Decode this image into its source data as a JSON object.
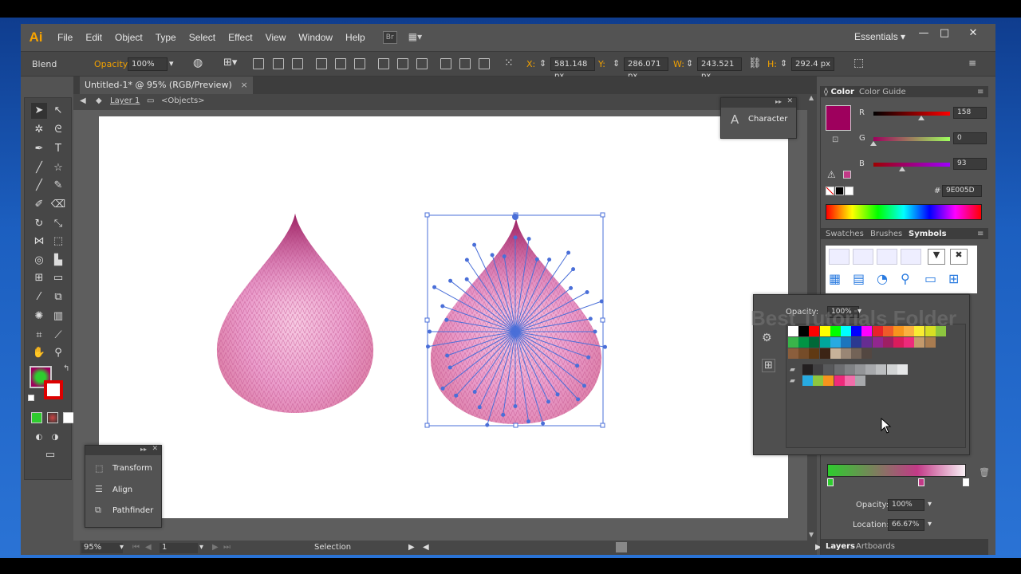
{
  "app": {
    "logo": "Ai",
    "workspace": "Essentials",
    "bridge_label": "Br",
    "window_controls": {
      "minimize": "—",
      "maximize": "□",
      "close": "✕"
    }
  },
  "menubar": {
    "items": [
      "File",
      "Edit",
      "Object",
      "Type",
      "Select",
      "Effect",
      "View",
      "Window",
      "Help"
    ]
  },
  "control": {
    "mode_label": "Blend",
    "opacity_label": "Opacity:",
    "opacity_value": "100%",
    "x_label": "X:",
    "x_value": "581.148 px",
    "y_label": "Y:",
    "y_value": "286.071 px",
    "w_label": "W:",
    "w_value": "243.521 px",
    "h_label": "H:",
    "h_value": "292.4 px"
  },
  "document": {
    "tab_title": "Untitled-1* @ 95% (RGB/Preview)",
    "close_icon": "×",
    "layer": "Layer 1",
    "objects": "<Objects>"
  },
  "character_panel": {
    "title": "Character",
    "glyph": "A"
  },
  "mini_panel": {
    "items": [
      "Transform",
      "Align",
      "Pathfinder"
    ]
  },
  "color_panel": {
    "tabs": [
      "Color",
      "Color Guide"
    ],
    "r_label": "R",
    "r_value": "158",
    "g_label": "G",
    "g_value": "0",
    "b_label": "B",
    "b_value": "93",
    "hash": "#",
    "hex": "9E005D",
    "fill_color": "#9e005d"
  },
  "library_tabs": [
    "Swatches",
    "Brushes",
    "Symbols"
  ],
  "swatch_popup": {
    "opacity_label": "Opacity:",
    "opacity_value": "100%",
    "watermark": "Best Tutorials Folder"
  },
  "gradient_panel": {
    "opacity_label": "Opacity:",
    "opacity_value": "100%",
    "location_label": "Location:",
    "location_value": "66.67%"
  },
  "bottom_tabs": [
    "Layers",
    "Artboards"
  ],
  "statusbar": {
    "zoom": "95%",
    "artboard": "1",
    "tool": "Selection"
  },
  "colors": {
    "pink_light": "#f2b6d8",
    "pink_mid": "#d96aa8",
    "pink_dark": "#9c2063",
    "selection": "#4a6fd8",
    "orange": "#f0a000",
    "green_stop": "#2ecc2e"
  }
}
